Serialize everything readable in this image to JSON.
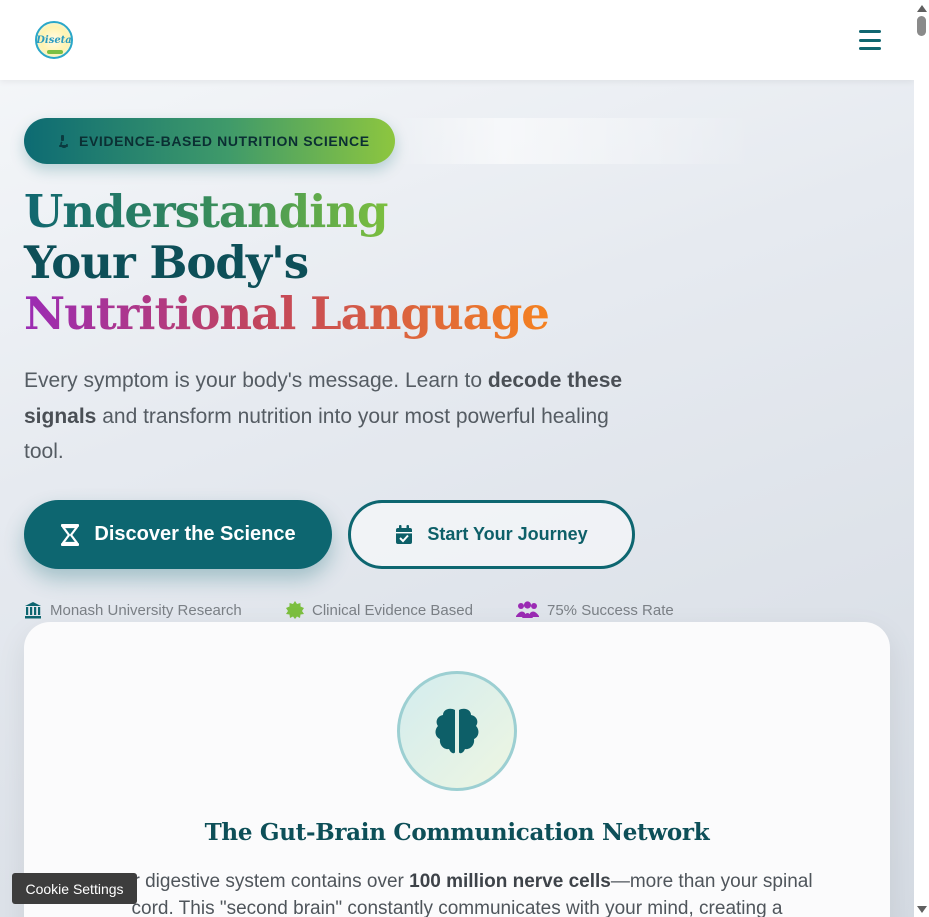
{
  "header": {
    "logo_text": "Diseta",
    "menu_label": "menu"
  },
  "hero": {
    "badge": "EVIDENCE-BASED NUTRITION SCIENCE",
    "title_line1": "Understanding",
    "title_line2": "Your Body's",
    "title_line3": "Nutritional Language",
    "desc_part1": "Every symptom is your body's message. Learn to ",
    "desc_bold1": "decode these signals",
    "desc_part2": " and transform nutrition into your most powerful healing tool.",
    "primary_button": "Discover the Science",
    "secondary_button": "Start Your Journey"
  },
  "trust": [
    {
      "label": "Monash University Research",
      "icon": "university-icon",
      "color": "#0d6670"
    },
    {
      "label": "Clinical Evidence Based",
      "icon": "certificate-icon",
      "color": "#7cbf3f"
    },
    {
      "label": "75% Success Rate",
      "icon": "users-icon",
      "color": "#9b2bb4"
    }
  ],
  "card": {
    "icon": "brain-icon",
    "title": "The Gut-Brain Communication Network",
    "text_part1": "Your digestive system contains over ",
    "text_bold": "100 million nerve cells",
    "text_part2": "—more than your spinal cord. This \"second brain\" constantly communicates with your mind, creating a"
  },
  "cookie": {
    "label": "Cookie Settings"
  },
  "colors": {
    "primary": "#0d6670",
    "accent_green": "#7cbf3f",
    "accent_purple": "#9b2bb4",
    "accent_orange": "#f58220"
  }
}
